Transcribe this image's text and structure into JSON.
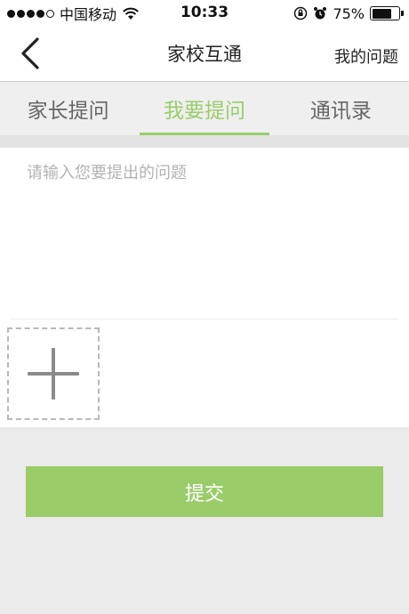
{
  "status_bar": {
    "carrier": "中国移动",
    "time": "10:33",
    "battery_percent": "75%",
    "battery_level": 0.75,
    "signal_bars_filled": 4,
    "signal_bars_total": 5
  },
  "nav": {
    "title": "家校互通",
    "right_button": "我的问题",
    "back_icon": "chevron-left-icon"
  },
  "tabs": [
    {
      "label": "家长提问",
      "active": false
    },
    {
      "label": "我要提问",
      "active": true
    },
    {
      "label": "通讯录",
      "active": false
    }
  ],
  "question": {
    "placeholder": "请输入您要提出的问题",
    "value": ""
  },
  "add_image": {
    "icon": "plus-icon"
  },
  "submit": {
    "label": "提交"
  },
  "colors": {
    "accent": "#9acd6a",
    "background": "#ebebeb",
    "tab_text": "#666666",
    "placeholder": "#b3b3b3"
  }
}
